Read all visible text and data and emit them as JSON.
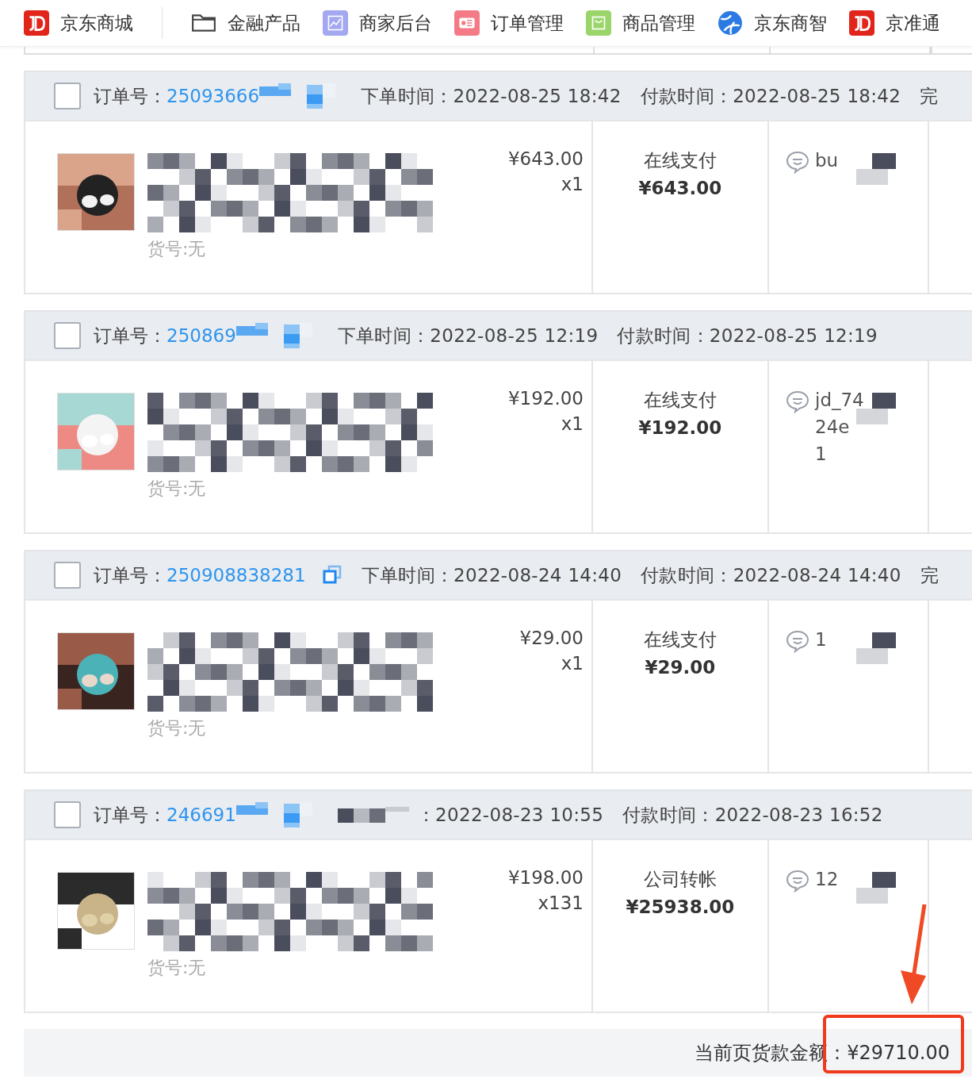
{
  "nav": [
    {
      "label": "京东商城"
    },
    {
      "label": "金融产品"
    },
    {
      "label": "商家后台"
    },
    {
      "label": "订单管理"
    },
    {
      "label": "商品管理"
    },
    {
      "label": "京东商智"
    },
    {
      "label": "京准通"
    }
  ],
  "orders": [
    {
      "checked": false,
      "number_label": "订单号：",
      "number": "25093666",
      "number_masked": true,
      "time_label_masked": false,
      "order_time": "下单时间：2022-08-25 18:42",
      "pay_time": "付款时间：2022-08-25 18:42",
      "status": "完",
      "sku": "货号:无",
      "price": "¥643.00",
      "qty": "x1",
      "pay_method": "在线支付",
      "pay_amount": "¥643.00",
      "buyer": [
        "bu"
      ]
    },
    {
      "checked": false,
      "number_label": "订单号：",
      "number": "250869",
      "number_masked": true,
      "time_label_masked": false,
      "order_time": "下单时间：2022-08-25 12:19",
      "pay_time": "付款时间：2022-08-25 12:19",
      "sku": "货号:无",
      "price": "¥192.00",
      "qty": "x1",
      "pay_method": "在线支付",
      "pay_amount": "¥192.00",
      "buyer": [
        "jd_74",
        "24e",
        "1"
      ]
    },
    {
      "checked": false,
      "number_label": "订单号：",
      "number": "250908838281",
      "number_masked": false,
      "time_label_masked": false,
      "order_time": "下单时间：2022-08-24 14:40",
      "pay_time": "付款时间：2022-08-24 14:40",
      "status": "完",
      "sku": "货号:无",
      "price": "¥29.00",
      "qty": "x1",
      "pay_method": "在线支付",
      "pay_amount": "¥29.00",
      "buyer": [
        "1"
      ]
    },
    {
      "checked": false,
      "number_label": "订单号：",
      "number": "246691",
      "number_masked": true,
      "time_label_masked": true,
      "order_time": "：2022-08-23 10:55",
      "pay_time": "付款时间：2022-08-23 16:52",
      "sku": "货号:无",
      "price": "¥198.00",
      "qty": "x131",
      "pay_method": "公司转帐",
      "pay_amount": "¥25938.00",
      "buyer": [
        "12"
      ]
    }
  ],
  "summary": {
    "label": "当前页货款金额：",
    "amount": "¥29710.00"
  }
}
